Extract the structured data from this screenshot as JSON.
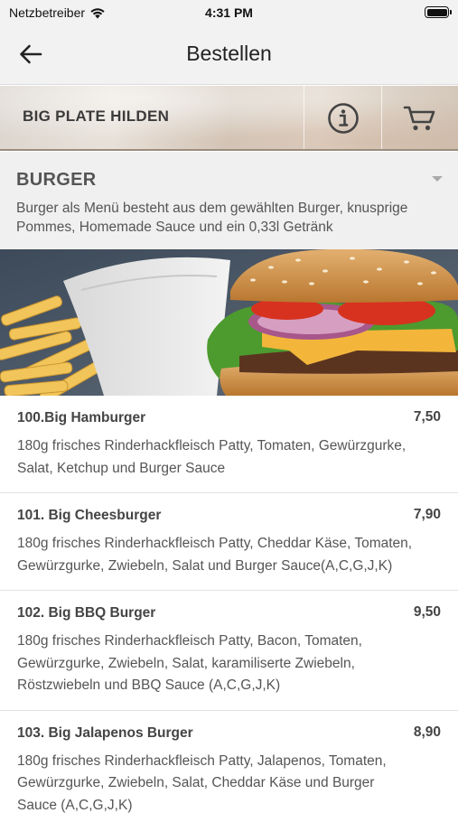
{
  "status_bar": {
    "carrier": "Netzbetreiber",
    "time": "4:31 PM"
  },
  "nav": {
    "title": "Bestellen"
  },
  "restaurant": {
    "name": "BIG PLATE HILDEN"
  },
  "category": {
    "title": "BURGER",
    "description": "Burger als Menü besteht aus dem gewählten Burger, knusprige Pommes, Homemade Sauce und ein 0,33l Getränk"
  },
  "menu_items": [
    {
      "name": "100.Big Hamburger",
      "price": "7,50",
      "description": "180g frisches Rinderhackfleisch Patty, Tomaten, Gewürzgurke, Salat, Ketchup und Burger Sauce"
    },
    {
      "name": "101. Big Cheesburger",
      "price": "7,90",
      "description": "180g frisches Rinderhackfleisch Patty, Cheddar Käse, Tomaten, Gewürzgurke, Zwiebeln, Salat und Burger Sauce(A,C,G,J,K)"
    },
    {
      "name": "102. Big BBQ Burger",
      "price": "9,50",
      "description": "180g frisches Rinderhackfleisch Patty, Bacon, Tomaten, Gewürzgurke, Zwiebeln, Salat, karamiliserte Zwiebeln, Röstzwiebeln und BBQ Sauce (A,C,G,J,K)"
    },
    {
      "name": "103. Big Jalapenos Burger",
      "price": "8,90",
      "description": "180g frisches Rinderhackfleisch Patty, Jalapenos, Tomaten, Gewürzgurke, Zwiebeln, Salat, Cheddar Käse und Burger Sauce (A,C,G,J,K)"
    }
  ]
}
